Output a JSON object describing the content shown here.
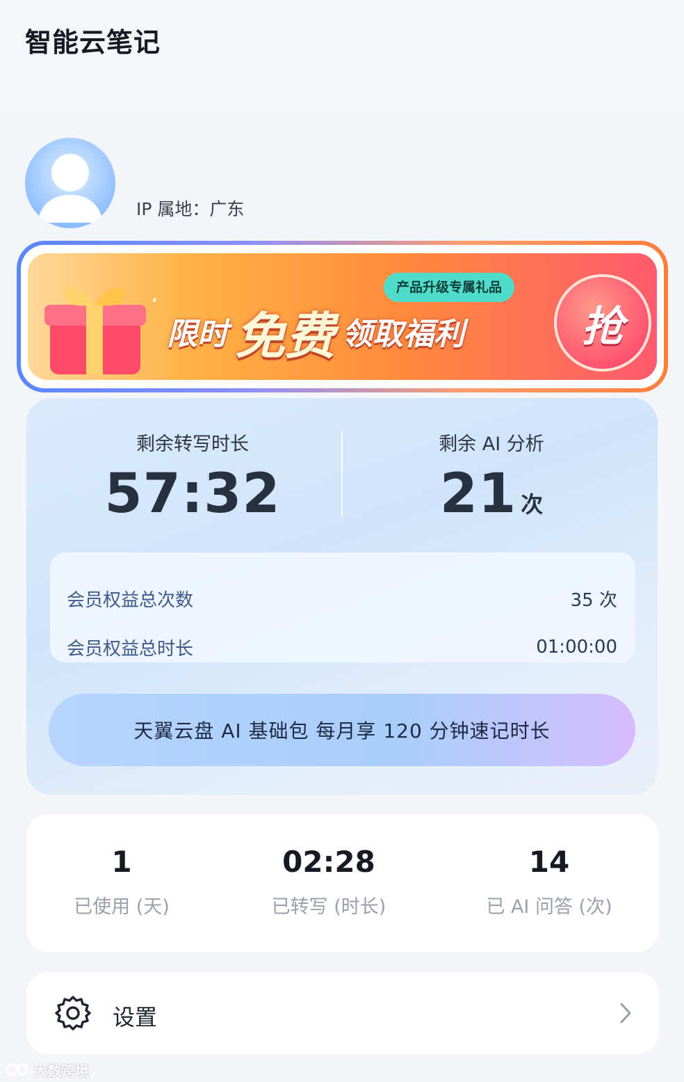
{
  "header": {
    "title": "智能云笔记"
  },
  "profile": {
    "ip_location": "IP 属地：广东"
  },
  "promo": {
    "tag": "产品升级专属礼品",
    "title_prefix": "限时",
    "title_highlight": "免费",
    "title_suffix": "领取福利",
    "grab_label": "抢"
  },
  "stats": {
    "transcribe_label": "剩余转写时长",
    "transcribe_value": "57:32",
    "ai_label": "剩余 AI 分析",
    "ai_value": "21",
    "ai_unit": "次",
    "benefits": [
      {
        "label": "会员权益总次数",
        "value": "35 次"
      },
      {
        "label": "会员权益总时长",
        "value": "01:00:00"
      }
    ],
    "plan_text": "天翼云盘 AI 基础包 每月享 120 分钟速记时长"
  },
  "usage": [
    {
      "value": "1",
      "label": "已使用 (天)"
    },
    {
      "value": "02:28",
      "label": "已转写 (时长)"
    },
    {
      "value": "14",
      "label": "已 AI 问答 (次)"
    }
  ],
  "settings": {
    "label": "设置",
    "icon": "gear-icon"
  },
  "watermark": {
    "text": "大数跨境"
  },
  "colors": {
    "accent_blue": "#5a86ff",
    "accent_orange": "#ff7e3b",
    "card_blue": "#cfe4fb"
  }
}
